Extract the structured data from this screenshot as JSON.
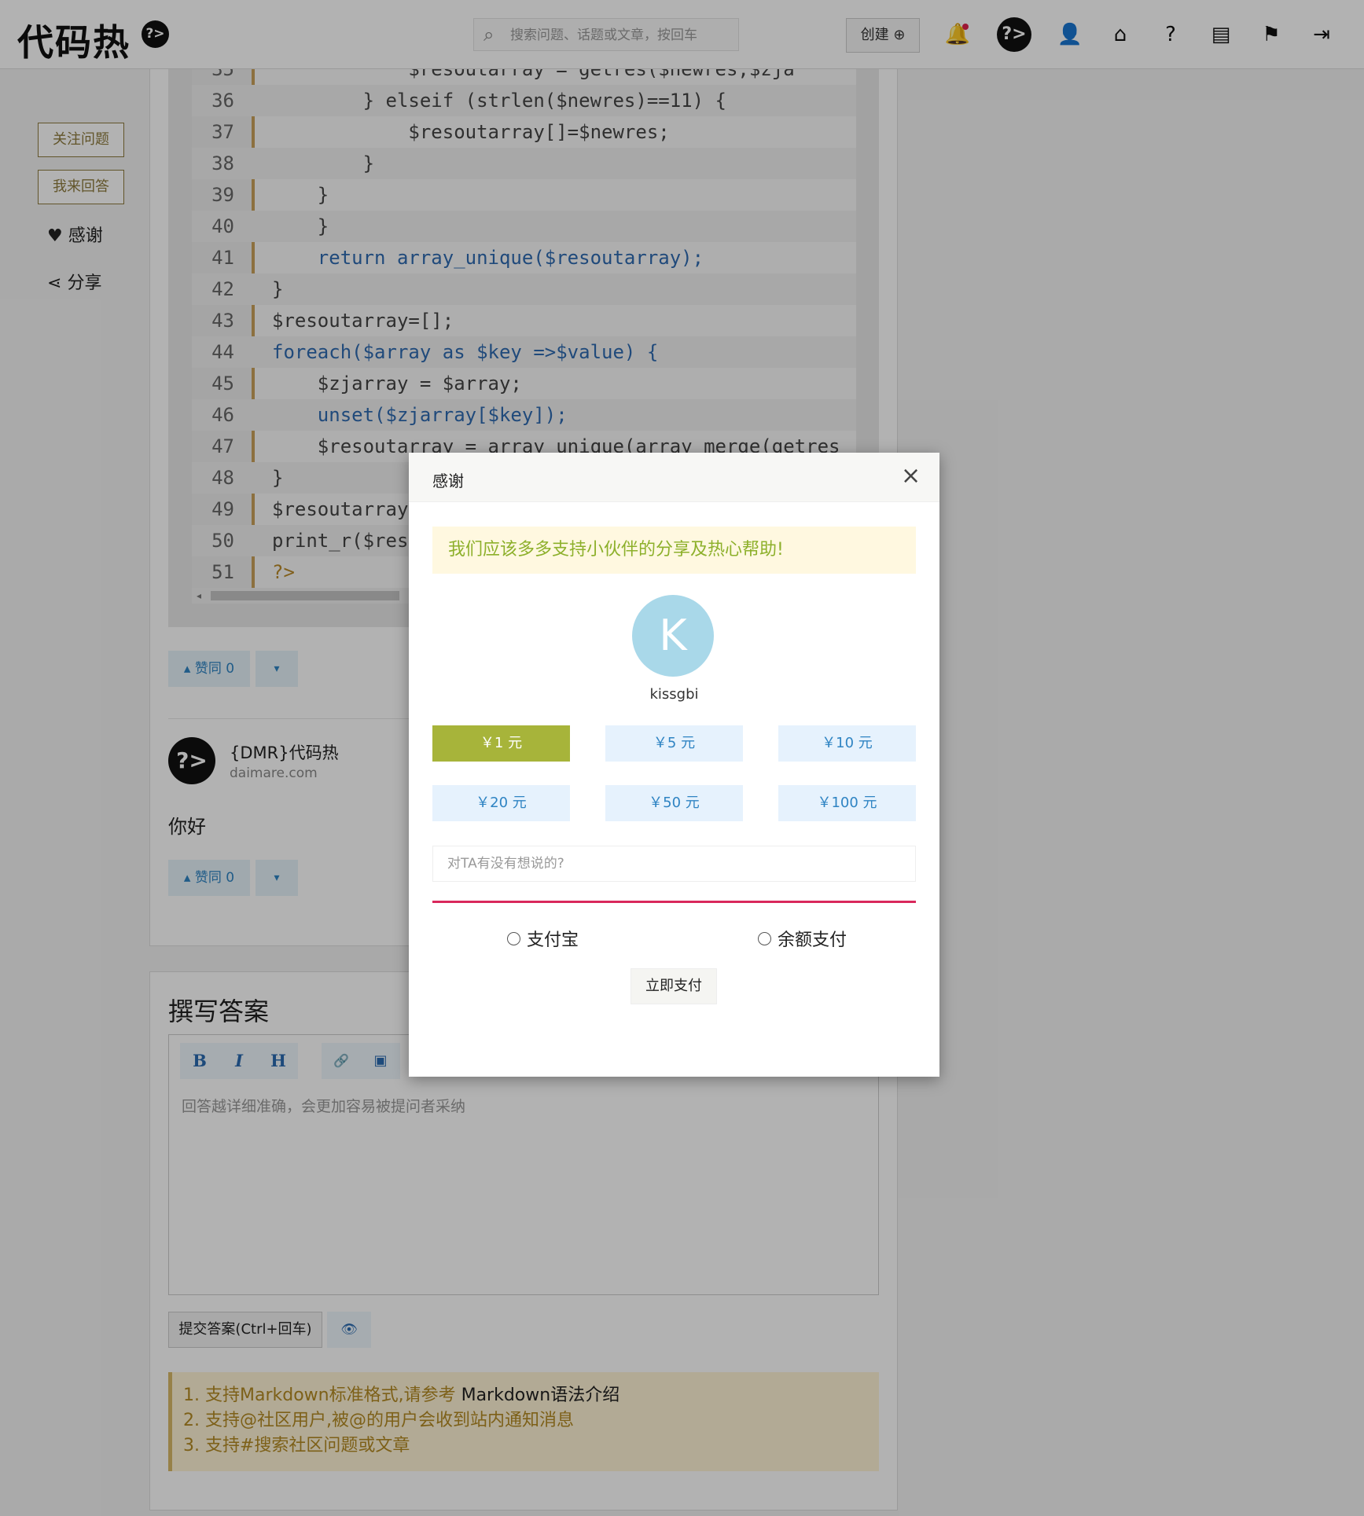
{
  "header": {
    "logo_text": "代码热",
    "logo_badge": "?>",
    "search_placeholder": "搜索问题、话题或文章，按回车",
    "create_label": "创建 ⊕",
    "avatar_text": "?>"
  },
  "side": {
    "follow_label": "关注问题",
    "answer_label": "我来回答",
    "thanks_label": "感谢",
    "share_label": "分享"
  },
  "code": {
    "lines": [
      {
        "n": "35",
        "text": "            $resoutarray = getres($newres,$zja"
      },
      {
        "n": "36",
        "text": "        } elseif (strlen($newres)==11) {"
      },
      {
        "n": "37",
        "text": "            $resoutarray[]=$newres;"
      },
      {
        "n": "38",
        "text": "        }"
      },
      {
        "n": "39",
        "text": "    }"
      },
      {
        "n": "40",
        "text": "    }"
      },
      {
        "n": "41",
        "text": "    return array_unique($resoutarray);"
      },
      {
        "n": "42",
        "text": "}"
      },
      {
        "n": "43",
        "text": "$resoutarray=[];"
      },
      {
        "n": "44",
        "text": "foreach($array as $key =>$value) {"
      },
      {
        "n": "45",
        "text": "    $zjarray = $array;"
      },
      {
        "n": "46",
        "text": "    unset($zjarray[$key]);"
      },
      {
        "n": "47",
        "text": "    $resoutarray = array_unique(array_merge(getres"
      },
      {
        "n": "48",
        "text": "}"
      },
      {
        "n": "49",
        "text": "$resoutarray"
      },
      {
        "n": "50",
        "text": "print_r($res"
      },
      {
        "n": "51",
        "text": "?>"
      }
    ]
  },
  "answer": {
    "vote_label": "▴ 赞同 0",
    "dropdown_label": "▾"
  },
  "comment": {
    "avatar_text": "?>",
    "name": "{DMR}代码热",
    "site": "daimare.com",
    "text": "你好",
    "vote_label": "▴ 赞同 0",
    "dropdown_label": "▾"
  },
  "write": {
    "title": "撰写答案",
    "tb_bold": "B",
    "tb_italic": "I",
    "tb_heading": "H",
    "tb_link": "🔗",
    "tb_image": "▣",
    "placeholder": "回答越详细准确，会更加容易被提问者采纳",
    "submit_label": "提交答案(Ctrl+回车)",
    "preview_label": "👁",
    "tips": {
      "tip1_prefix": "1. 支持Markdown标准格式,请参考 ",
      "tip1_link": "Markdown语法介绍",
      "tip2": "2. 支持@社区用户,被@的用户会收到站内通知消息",
      "tip3": "3. 支持#搜索社区问题或文章"
    }
  },
  "modal": {
    "title": "感谢",
    "close": "×",
    "notice": "我们应该多多支持小伙伴的分享及热心帮助!",
    "avatar_letter": "K",
    "username": "kissgbi",
    "amounts": [
      "￥1 元",
      "￥5 元",
      "￥10 元",
      "￥20 元",
      "￥50 元",
      "￥100 元"
    ],
    "message_placeholder": "对TA有没有想说的?",
    "pay_alipay": "支付宝",
    "pay_balance": "余额支付",
    "pay_button": "立即支付"
  },
  "colors": {
    "accent_gold": "#8d7a3d",
    "selected_amount": "#a7b43a",
    "link_blue": "#2f84c3",
    "notice_green": "#8db02b",
    "divider_red": "#d9285c"
  }
}
